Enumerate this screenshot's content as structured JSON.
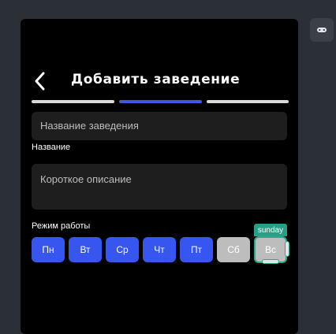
{
  "header": {
    "title": "Добавить заведение",
    "back_icon": "chevron-left-icon"
  },
  "progress": {
    "steps": 3,
    "current_step": 2,
    "colors": {
      "done": "#d9d9d9",
      "active": "#3b5be0"
    }
  },
  "form": {
    "name_placeholder": "Название заведения",
    "name_label": "Название",
    "description_placeholder": "Короткое описание",
    "schedule_label": "Режим работы"
  },
  "days": [
    {
      "label": "Пн",
      "active": true
    },
    {
      "label": "Вт",
      "active": true
    },
    {
      "label": "Ср",
      "active": true
    },
    {
      "label": "Чт",
      "active": true
    },
    {
      "label": "Пт",
      "active": true
    },
    {
      "label": "Сб",
      "active": false
    },
    {
      "label": "Вс",
      "active": false
    }
  ],
  "selection_tag": "sunday",
  "colors": {
    "accent": "#3756f0",
    "inactive": "#bdbdbd",
    "selection": "#27a085",
    "background": "#000000"
  }
}
